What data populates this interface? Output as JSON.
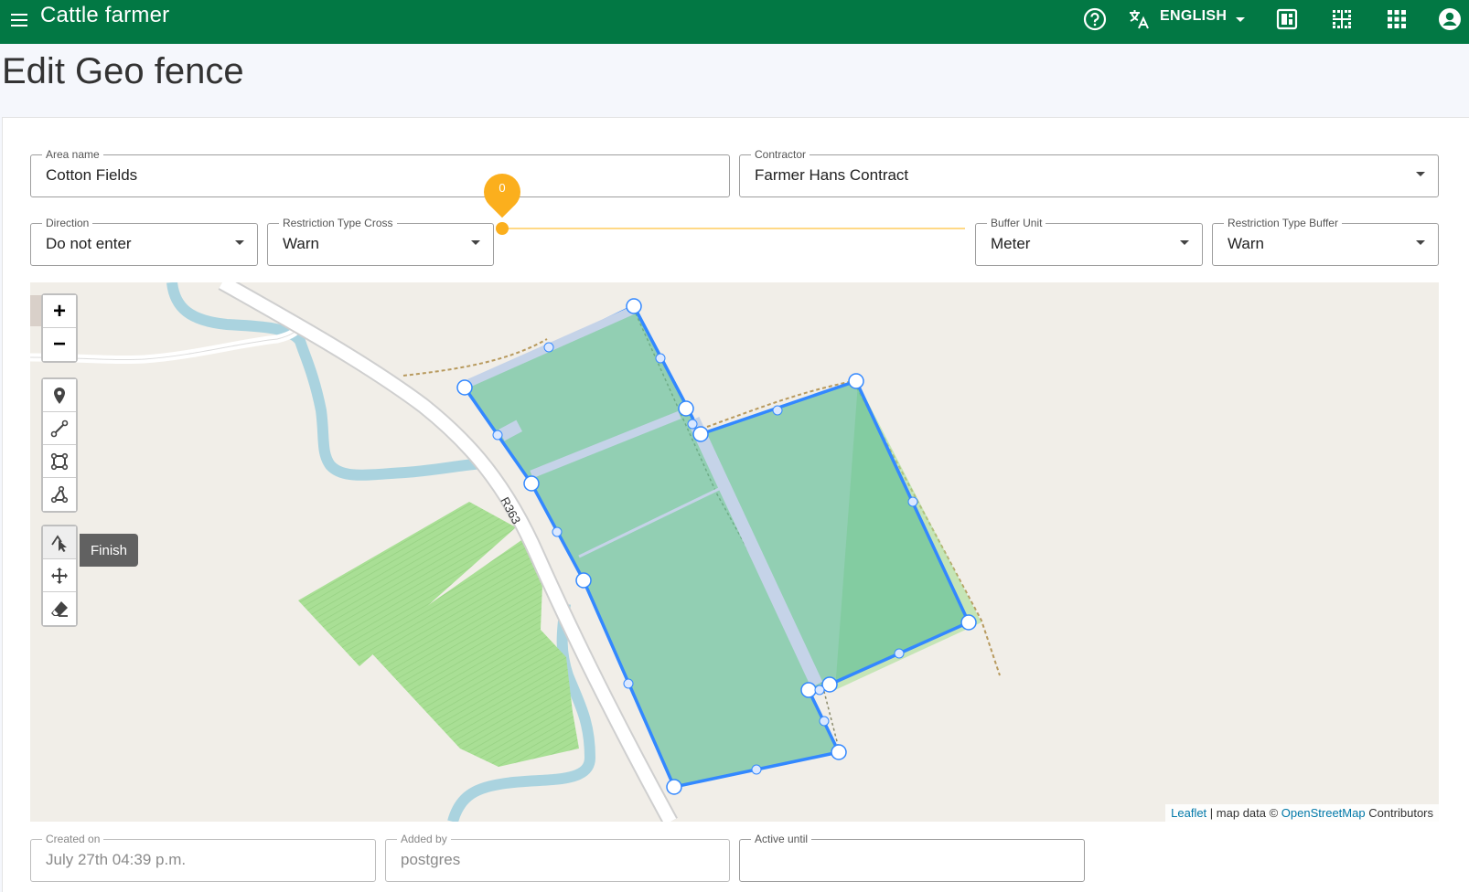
{
  "app": {
    "title": "Cattle farmer"
  },
  "header": {
    "language": "ENGLISH",
    "icons": [
      "menu-icon",
      "help-icon",
      "translate-icon",
      "chevron-down-icon",
      "dashboard-icon",
      "grid-fence-icon",
      "apps-icon",
      "account-icon"
    ]
  },
  "page": {
    "title": "Edit Geo fence"
  },
  "form": {
    "area_name": {
      "label": "Area name",
      "value": "Cotton Fields"
    },
    "contractor": {
      "label": "Contractor",
      "value": "Farmer Hans Contract"
    },
    "direction": {
      "label": "Direction",
      "value": "Do not enter"
    },
    "restriction_cross": {
      "label": "Restriction Type Cross",
      "value": "Warn"
    },
    "buffer_slider": {
      "value": "0"
    },
    "buffer_unit": {
      "label": "Buffer Unit",
      "value": "Meter"
    },
    "restriction_buffer": {
      "label": "Restriction Type Buffer",
      "value": "Warn"
    },
    "created_on": {
      "label": "Created on",
      "value": "July 27th 04:39 p.m."
    },
    "added_by": {
      "label": "Added by",
      "value": "postgres"
    },
    "active_until": {
      "label": "Active until",
      "value": ""
    }
  },
  "map": {
    "zoom_in": "+",
    "zoom_out": "−",
    "tooltip": "Finish",
    "road_label": "R363",
    "attribution": {
      "leaflet": "Leaflet",
      "middle": " | map data © ",
      "osm": "OpenStreetMap",
      "suffix": " Contributors"
    },
    "colors": {
      "fence": "#3388ff",
      "field": "#8ccfb0",
      "water": "#aad3df",
      "meadow": "#a9df95"
    }
  }
}
